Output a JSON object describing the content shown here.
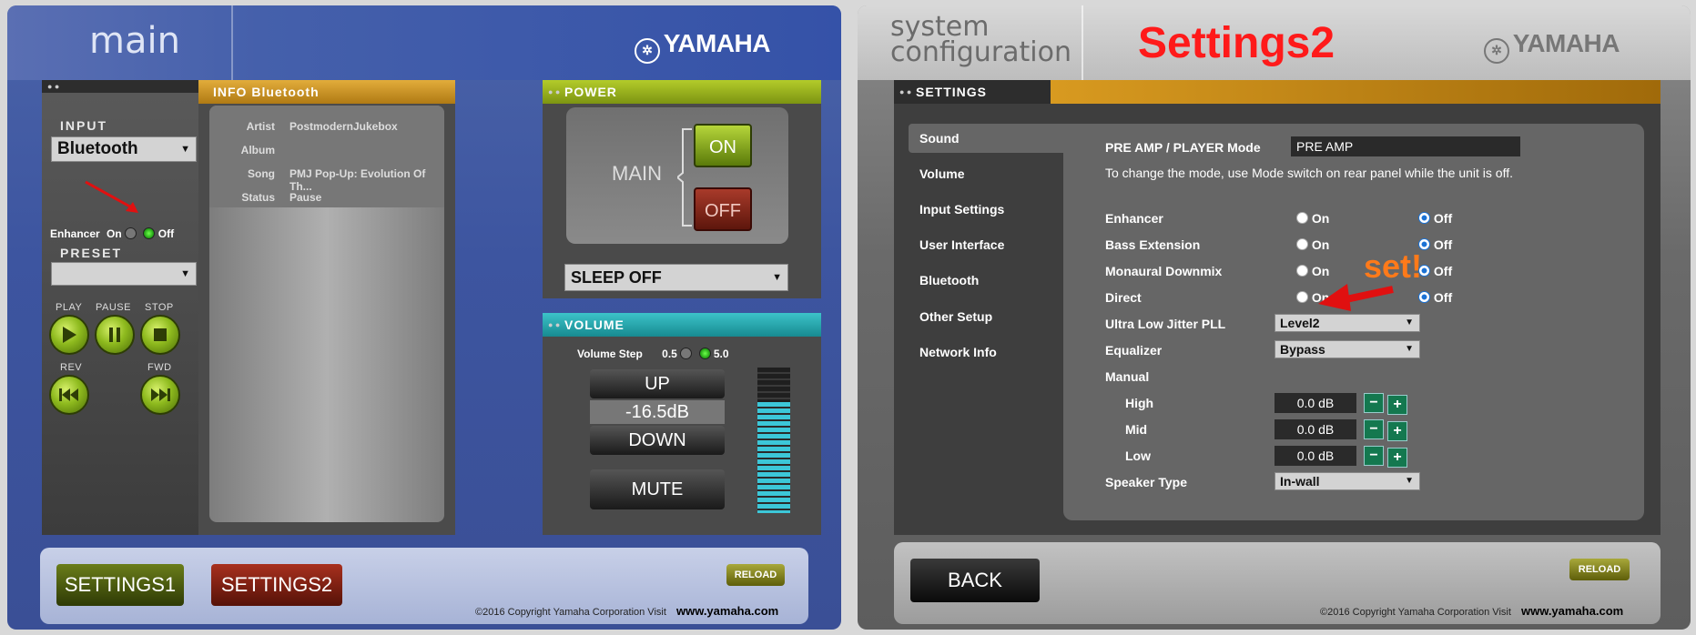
{
  "left": {
    "title": "main",
    "brand": "YAMAHA",
    "input": {
      "label": "INPUT",
      "value": "Bluetooth"
    },
    "enhancer": {
      "label": "Enhancer",
      "on": "On",
      "off": "Off"
    },
    "preset": {
      "label": "PRESET",
      "value": ""
    },
    "transport": {
      "play": "PLAY",
      "pause": "PAUSE",
      "stop": "STOP",
      "rev": "REV",
      "fwd": "FWD"
    },
    "info": {
      "title": "INFO Bluetooth",
      "rows": [
        {
          "key": "Artist",
          "value": "PostmodernJukebox"
        },
        {
          "key": "Album",
          "value": ""
        },
        {
          "key": "Song",
          "value": "PMJ Pop-Up: Evolution Of Th..."
        },
        {
          "key": "Status",
          "value": "Pause"
        }
      ]
    },
    "power": {
      "title": "POWER",
      "main": "MAIN",
      "on": "ON",
      "off": "OFF",
      "sleep": "SLEEP OFF"
    },
    "volume": {
      "title": "VOLUME",
      "step_label": "Volume Step",
      "step_a": "0.5",
      "step_b": "5.0",
      "up": "UP",
      "level": "-16.5dB",
      "down": "DOWN",
      "mute": "MUTE"
    },
    "footer": {
      "settings1": "SETTINGS1",
      "settings2": "SETTINGS2",
      "reload": "RELOAD",
      "copyright": "©2016 Copyright Yamaha Corporation Visit",
      "site": "www.yamaha.com"
    }
  },
  "right": {
    "title_line1": "system",
    "title_line2": "configuration",
    "overlay_title": "Settings2",
    "brand": "YAMAHA",
    "section": "SETTINGS",
    "nav": [
      "Sound",
      "Volume",
      "Input Settings",
      "User Interface",
      "Bluetooth",
      "Other Setup",
      "Network Info"
    ],
    "mode": {
      "label": "PRE AMP / PLAYER Mode",
      "value": "PRE AMP",
      "note": "To change the mode, use Mode switch on rear panel while the unit is off."
    },
    "toggles": [
      {
        "label": "Enhancer",
        "on": "On",
        "off": "Off"
      },
      {
        "label": "Bass Extension",
        "on": "On",
        "off": "Off"
      },
      {
        "label": "Monaural Downmix",
        "on": "On",
        "off": "Off"
      },
      {
        "label": "Direct",
        "on": "On",
        "off": "Off"
      }
    ],
    "annotation": "set!",
    "ultra": {
      "label": "Ultra Low Jitter PLL",
      "value": "Level2"
    },
    "equalizer": {
      "label": "Equalizer",
      "value": "Bypass"
    },
    "manual": {
      "label": "Manual"
    },
    "bands": [
      {
        "label": "High",
        "value": "0.0 dB"
      },
      {
        "label": "Mid",
        "value": "0.0 dB"
      },
      {
        "label": "Low",
        "value": "0.0 dB"
      }
    ],
    "speaker": {
      "label": "Speaker Type",
      "value": "In-wall"
    },
    "footer": {
      "back": "BACK",
      "reload": "RELOAD",
      "copyright": "©2016 Copyright Yamaha Corporation Visit",
      "site": "www.yamaha.com"
    }
  }
}
